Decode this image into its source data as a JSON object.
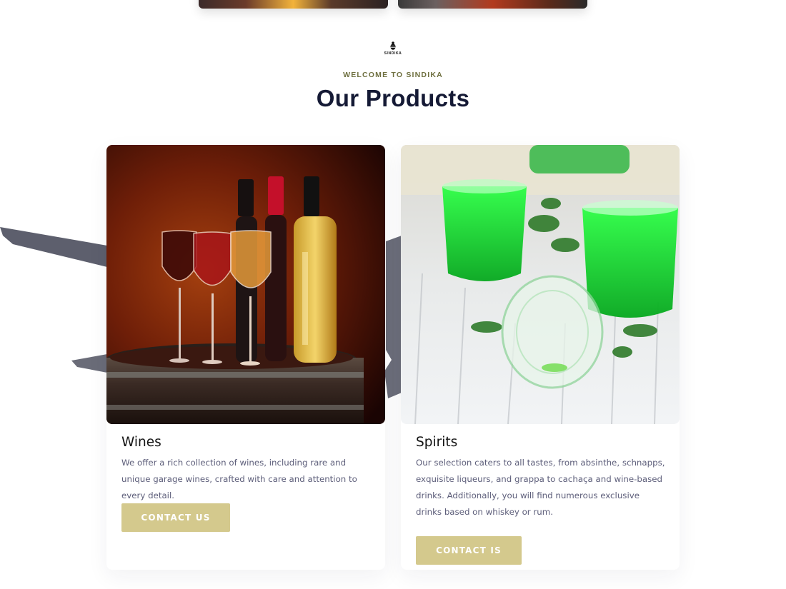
{
  "logo": {
    "text": "SINDIKA",
    "icon": "bee-logo-icon"
  },
  "section": {
    "eyebrow": "WELCOME TO SINDIKA",
    "title": "Our Products"
  },
  "products": [
    {
      "name": "Wines",
      "description": "We offer a rich collection of wines, including rare and unique garage wines, crafted with care and attention to every detail.",
      "button_label": "CONTACT US",
      "image": "wine-bottles-glasses-barrel-image"
    },
    {
      "name": "Spirits",
      "description": "Our selection caters to all tastes, from absinthe, schnapps, exquisite liqueurs, and grappa to cachaça and wine-based drinks. Additionally, you will find numerous exclusive drinks based on whiskey or rum.",
      "button_label": "CONTACT IS",
      "image": "green-absinthe-shots-image"
    }
  ],
  "colors": {
    "accent_button": "#d4c98d",
    "eyebrow": "#6f7040",
    "title": "#151a35",
    "body_text": "#5d5e7a"
  }
}
